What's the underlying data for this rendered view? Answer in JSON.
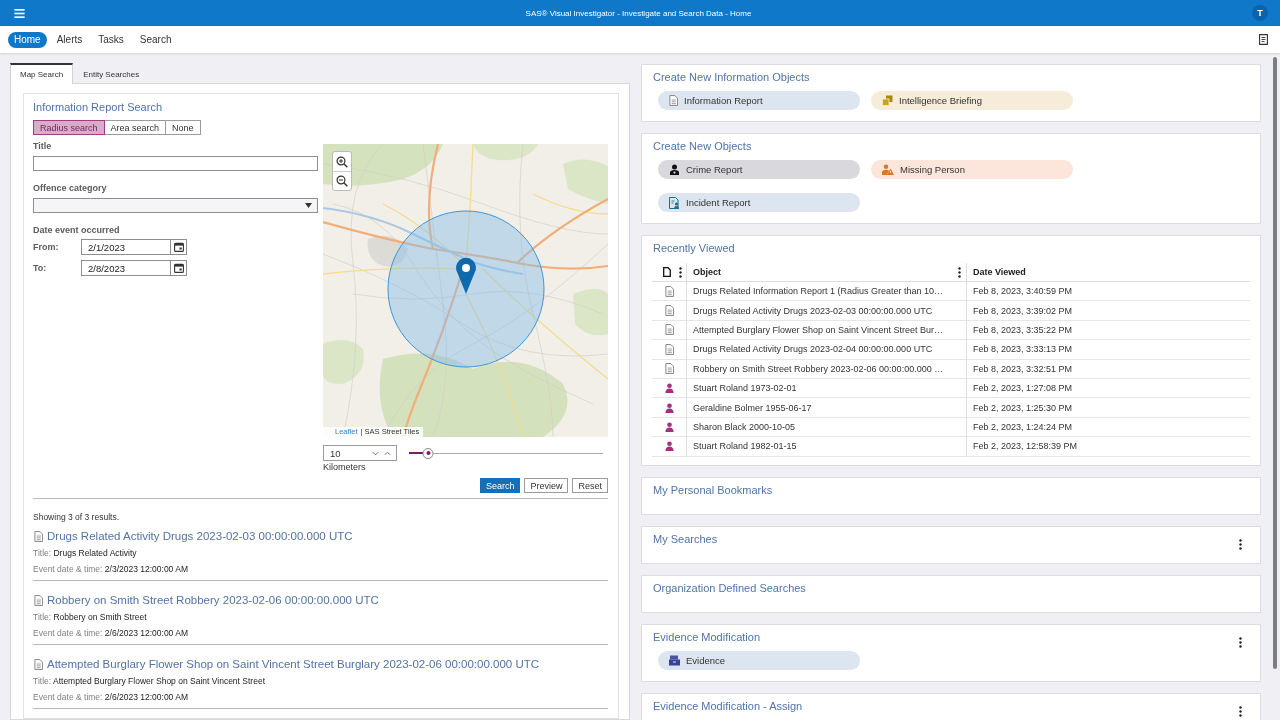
{
  "top_bar": {
    "title": "SAS® Visual Investigator - Investigate and Search Data - Home",
    "user_initial": "T"
  },
  "nav": {
    "items": [
      {
        "label": "Home",
        "selected": true
      },
      {
        "label": "Alerts",
        "selected": false
      },
      {
        "label": "Tasks",
        "selected": false
      },
      {
        "label": "Search",
        "selected": false
      }
    ]
  },
  "left_panel": {
    "tabs": [
      {
        "label": "Map Search",
        "selected": true
      },
      {
        "label": "Entity Searches",
        "selected": false
      }
    ],
    "search_card": {
      "heading": "Information Report Search",
      "modes": [
        {
          "label": "Radius search",
          "selected": true
        },
        {
          "label": "Area search",
          "selected": false
        },
        {
          "label": "None",
          "selected": false
        }
      ],
      "fields": [
        {
          "kind": "text",
          "label": "Title"
        },
        {
          "kind": "select",
          "label": "Offence category"
        }
      ],
      "date_group": {
        "label": "Date event occurred",
        "ranges": [
          {
            "label": "From:",
            "value": "2/1/2023"
          },
          {
            "label": "To:",
            "value": "2/8/2023"
          }
        ]
      },
      "map": {
        "attribution_link": "Leaflet",
        "attribution_text": "| SAS Street Tiles"
      },
      "radius": {
        "value": "10",
        "unit": "Kilometers",
        "level": 0.1
      },
      "buttons": [
        {
          "label": "Search",
          "kind": "primary"
        },
        {
          "label": "Preview",
          "kind": "secondary"
        },
        {
          "label": "Reset",
          "kind": "secondary"
        }
      ],
      "summary": "Showing 3 of 3 results.",
      "results": [
        {
          "title": "Drugs Related Activity Drugs 2023-02-03 00:00:00.000 UTC",
          "fields": [
            {
              "label": "Title:",
              "value": "Drugs Related Activity"
            },
            {
              "label": "Event date & time:",
              "value": "2/3/2023 12:00:00 AM"
            }
          ]
        },
        {
          "title": "Robbery on Smith Street Robbery 2023-02-06 00:00:00.000 UTC",
          "fields": [
            {
              "label": "Title:",
              "value": "Robbery on Smith Street"
            },
            {
              "label": "Event date & time:",
              "value": "2/6/2023 12:00:00 AM"
            }
          ]
        },
        {
          "title": "Attempted Burglary Flower Shop on Saint Vincent Street Burglary 2023-02-06 00:00:00.000 UTC",
          "fields": [
            {
              "label": "Title:",
              "value": "Attempted Burglary Flower Shop on Saint Vincent Street"
            },
            {
              "label": "Event date & time:",
              "value": "2/6/2023 12:00:00 AM"
            }
          ]
        }
      ]
    }
  },
  "right_panel": {
    "cards": [
      {
        "heading": "Create New Information Objects",
        "kind": "actions",
        "menu": false,
        "actions": [
          {
            "label": "Information Report",
            "kind": "document",
            "color": "#dde5f0"
          },
          {
            "label": "Intelligence Briefing",
            "kind": "briefing",
            "color": "#f6ecda"
          }
        ]
      },
      {
        "heading": "Create New Objects",
        "kind": "actions",
        "menu": false,
        "actions": [
          {
            "label": "Crime Report",
            "kind": "crime",
            "color": "#d9d8dc"
          },
          {
            "label": "Missing Person",
            "kind": "missing-person",
            "color": "#fce5da"
          },
          {
            "label": "Incident Report",
            "kind": "incident",
            "color": "#dde5f0"
          }
        ]
      },
      {
        "heading": "Recently Viewed",
        "kind": "table",
        "menu": false,
        "table": {
          "columns": [
            {
              "label": "Object",
              "menu": true
            },
            {
              "label": "Date Viewed",
              "menu": false
            }
          ],
          "rows": [
            {
              "kind": "document",
              "object": "Drugs Related Information Report 1 (Radius Greater than 10…",
              "date": "Feb 8, 2023, 3:40:59 PM"
            },
            {
              "kind": "document",
              "object": "Drugs Related Activity Drugs 2023-02-03 00:00:00.000 UTC",
              "date": "Feb 8, 2023, 3:39:02 PM"
            },
            {
              "kind": "document",
              "object": "Attempted Burglary Flower Shop on Saint Vincent Street Bur…",
              "date": "Feb 8, 2023, 3:35:22 PM"
            },
            {
              "kind": "document",
              "object": "Drugs Related Activity Drugs 2023-02-04 00:00:00.000 UTC",
              "date": "Feb 8, 2023, 3:33:13 PM"
            },
            {
              "kind": "document",
              "object": "Robbery on Smith Street Robbery 2023-02-06 00:00:00.000 …",
              "date": "Feb 8, 2023, 3:32:51 PM"
            },
            {
              "kind": "person",
              "object": "Stuart Roland 1973-02-01",
              "date": "Feb 2, 2023, 1:27:08 PM"
            },
            {
              "kind": "person",
              "object": "Geraldine Bolmer 1955-06-17",
              "date": "Feb 2, 2023, 1:25:30 PM"
            },
            {
              "kind": "person",
              "object": "Sharon Black 2000-10-05",
              "date": "Feb 2, 2023, 1:24:24 PM"
            },
            {
              "kind": "person",
              "object": "Stuart Roland 1982-01-15",
              "date": "Feb 2, 2023, 12:58:39 PM"
            }
          ]
        }
      },
      {
        "heading": "My Personal Bookmarks",
        "kind": "empty",
        "menu": false
      },
      {
        "heading": "My Searches",
        "kind": "empty",
        "menu": true
      },
      {
        "heading": "Organization Defined Searches",
        "kind": "empty",
        "menu": false
      },
      {
        "heading": "Evidence Modification",
        "kind": "actions",
        "menu": true,
        "actions": [
          {
            "label": "Evidence",
            "kind": "evidence",
            "color": "#dde5f0"
          }
        ]
      },
      {
        "heading": "Evidence Modification - Assign",
        "kind": "empty",
        "menu": true
      }
    ]
  }
}
